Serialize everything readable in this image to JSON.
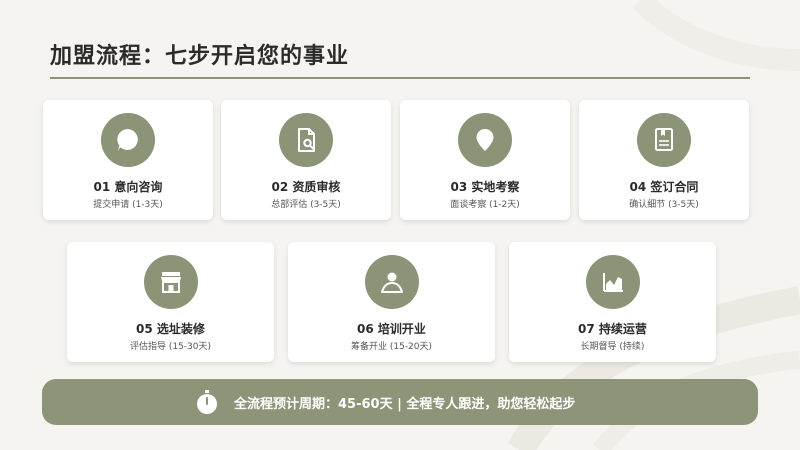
{
  "page": {
    "title": "加盟流程：七步开启您的事业"
  },
  "steps": [
    {
      "title": "01 意向咨询",
      "subtitle": "提交申请 (1-3天)",
      "icon": "chat-bubble-icon"
    },
    {
      "title": "02 资质审核",
      "subtitle": "总部评估 (3-5天)",
      "icon": "document-search-icon"
    },
    {
      "title": "03 实地考察",
      "subtitle": "面谈考察 (1-2天)",
      "icon": "location-pin-icon"
    },
    {
      "title": "04 签订合同",
      "subtitle": "确认细节 (3-5天)",
      "icon": "contract-book-icon"
    },
    {
      "title": "05 选址装修",
      "subtitle": "评估指导 (15-30天)",
      "icon": "storefront-icon"
    },
    {
      "title": "06 培训开业",
      "subtitle": "筹备开业 (15-20天)",
      "icon": "person-training-icon"
    },
    {
      "title": "07 持续运营",
      "subtitle": "长期督导 (持续)",
      "icon": "growth-chart-icon"
    }
  ],
  "summary": {
    "text": "全流程预计周期：45-60天 | 全程专人跟进，助您轻松起步",
    "icon": "stopwatch-icon"
  },
  "colors": {
    "accent": "#8c9478",
    "background": "#f5f4f0",
    "card": "#ffffff",
    "title": "#2b2b2b"
  }
}
